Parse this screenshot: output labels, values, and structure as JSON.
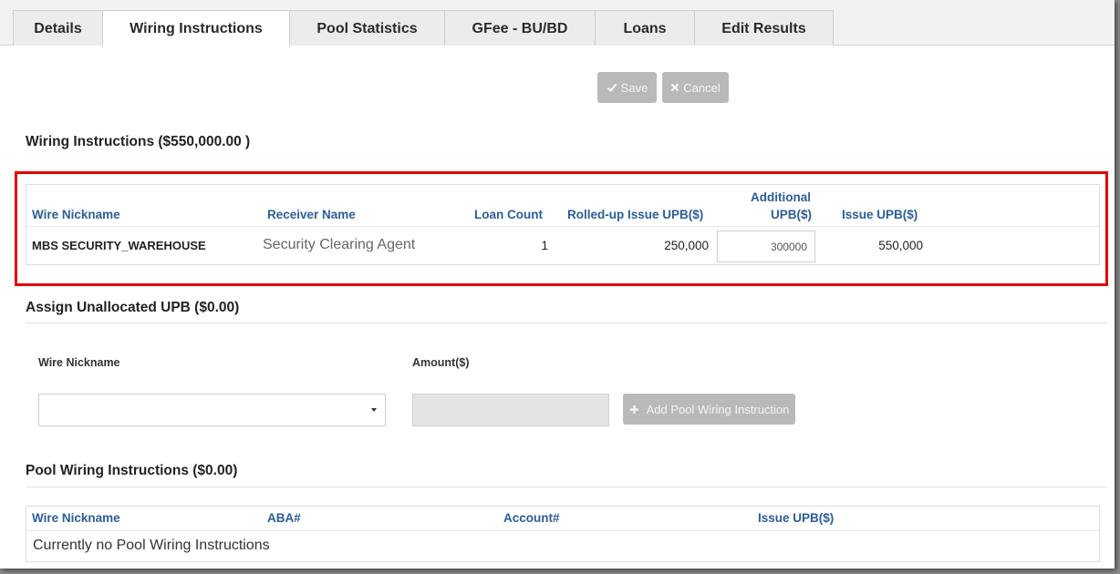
{
  "tabs": [
    {
      "label": "Details",
      "active": false
    },
    {
      "label": "Wiring Instructions",
      "active": true
    },
    {
      "label": "Pool Statistics",
      "active": false
    },
    {
      "label": "GFee - BU/BD",
      "active": false
    },
    {
      "label": "Loans",
      "active": false
    },
    {
      "label": "Edit Results",
      "active": false
    }
  ],
  "toolbar": {
    "save_label": "Save",
    "cancel_label": "Cancel"
  },
  "wiring": {
    "title": "Wiring Instructions ($550,000.00 )",
    "headers": {
      "wire_nickname": "Wire Nickname",
      "receiver_name": "Receiver Name",
      "loan_count": "Loan Count",
      "rolled_up": "Rolled-up Issue UPB($)",
      "additional_line1": "Additional",
      "additional_line2": "UPB($)",
      "issue_upb": "Issue UPB($)"
    },
    "rows": [
      {
        "wire_nickname": "MBS SECURITY_WAREHOUSE",
        "receiver_name": "Security Clearing Agent",
        "loan_count": "1",
        "rolled_up": "250,000",
        "additional": "300000",
        "issue_upb": "550,000"
      }
    ]
  },
  "assign": {
    "title": "Assign Unallocated UPB ($0.00)",
    "wire_label": "Wire Nickname",
    "amount_label": "Amount($)",
    "add_button": "Add Pool Wiring Instruction"
  },
  "pool": {
    "title": "Pool Wiring Instructions ($0.00)",
    "headers": {
      "wire_nickname": "Wire Nickname",
      "aba": "ABA#",
      "account": "Account#",
      "issue_upb": "Issue UPB($)"
    },
    "empty_text": "Currently no Pool Wiring Instructions"
  },
  "colors": {
    "header_blue": "#2c5e93",
    "highlight_red": "#e00000",
    "disabled_button": "#b9b9b9"
  }
}
